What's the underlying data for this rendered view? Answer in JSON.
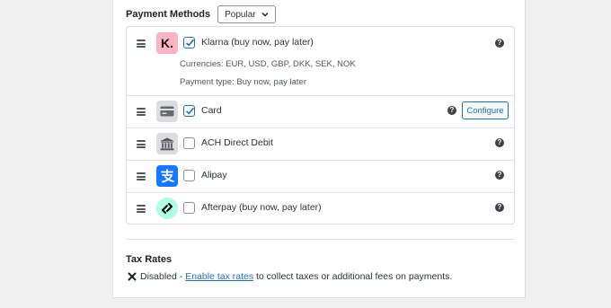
{
  "payment_methods": {
    "title": "Payment Methods",
    "filter": {
      "selected": "Popular"
    }
  },
  "methods": [
    {
      "name": "Klarna (buy now, pay later)",
      "checked": true,
      "logo": "klarna-logo",
      "currencies": "Currencies: EUR, USD, GBP, DKK, SEK, NOK",
      "payment_type": "Payment type: Buy now, pay later"
    },
    {
      "name": "Card",
      "checked": true,
      "logo": "credit-card-icon",
      "configure_label": "Configure"
    },
    {
      "name": "ACH Direct Debit",
      "checked": false,
      "logo": "bank-icon"
    },
    {
      "name": "Alipay",
      "checked": false,
      "logo": "alipay-logo"
    },
    {
      "name": "Afterpay (buy now, pay later)",
      "checked": false,
      "logo": "afterpay-logo"
    }
  ],
  "help_glyph": "?",
  "klarna_letter": "K.",
  "tax": {
    "title": "Tax Rates",
    "status": "Disabled",
    "separator": " - ",
    "link": "Enable tax rates",
    "suffix": " to collect taxes or additional fees on payments."
  },
  "colors": {
    "accent": "#2271b1",
    "klarna": "#ffb3c7",
    "alipay": "#1677ff",
    "afterpay": "#b2fce4"
  }
}
